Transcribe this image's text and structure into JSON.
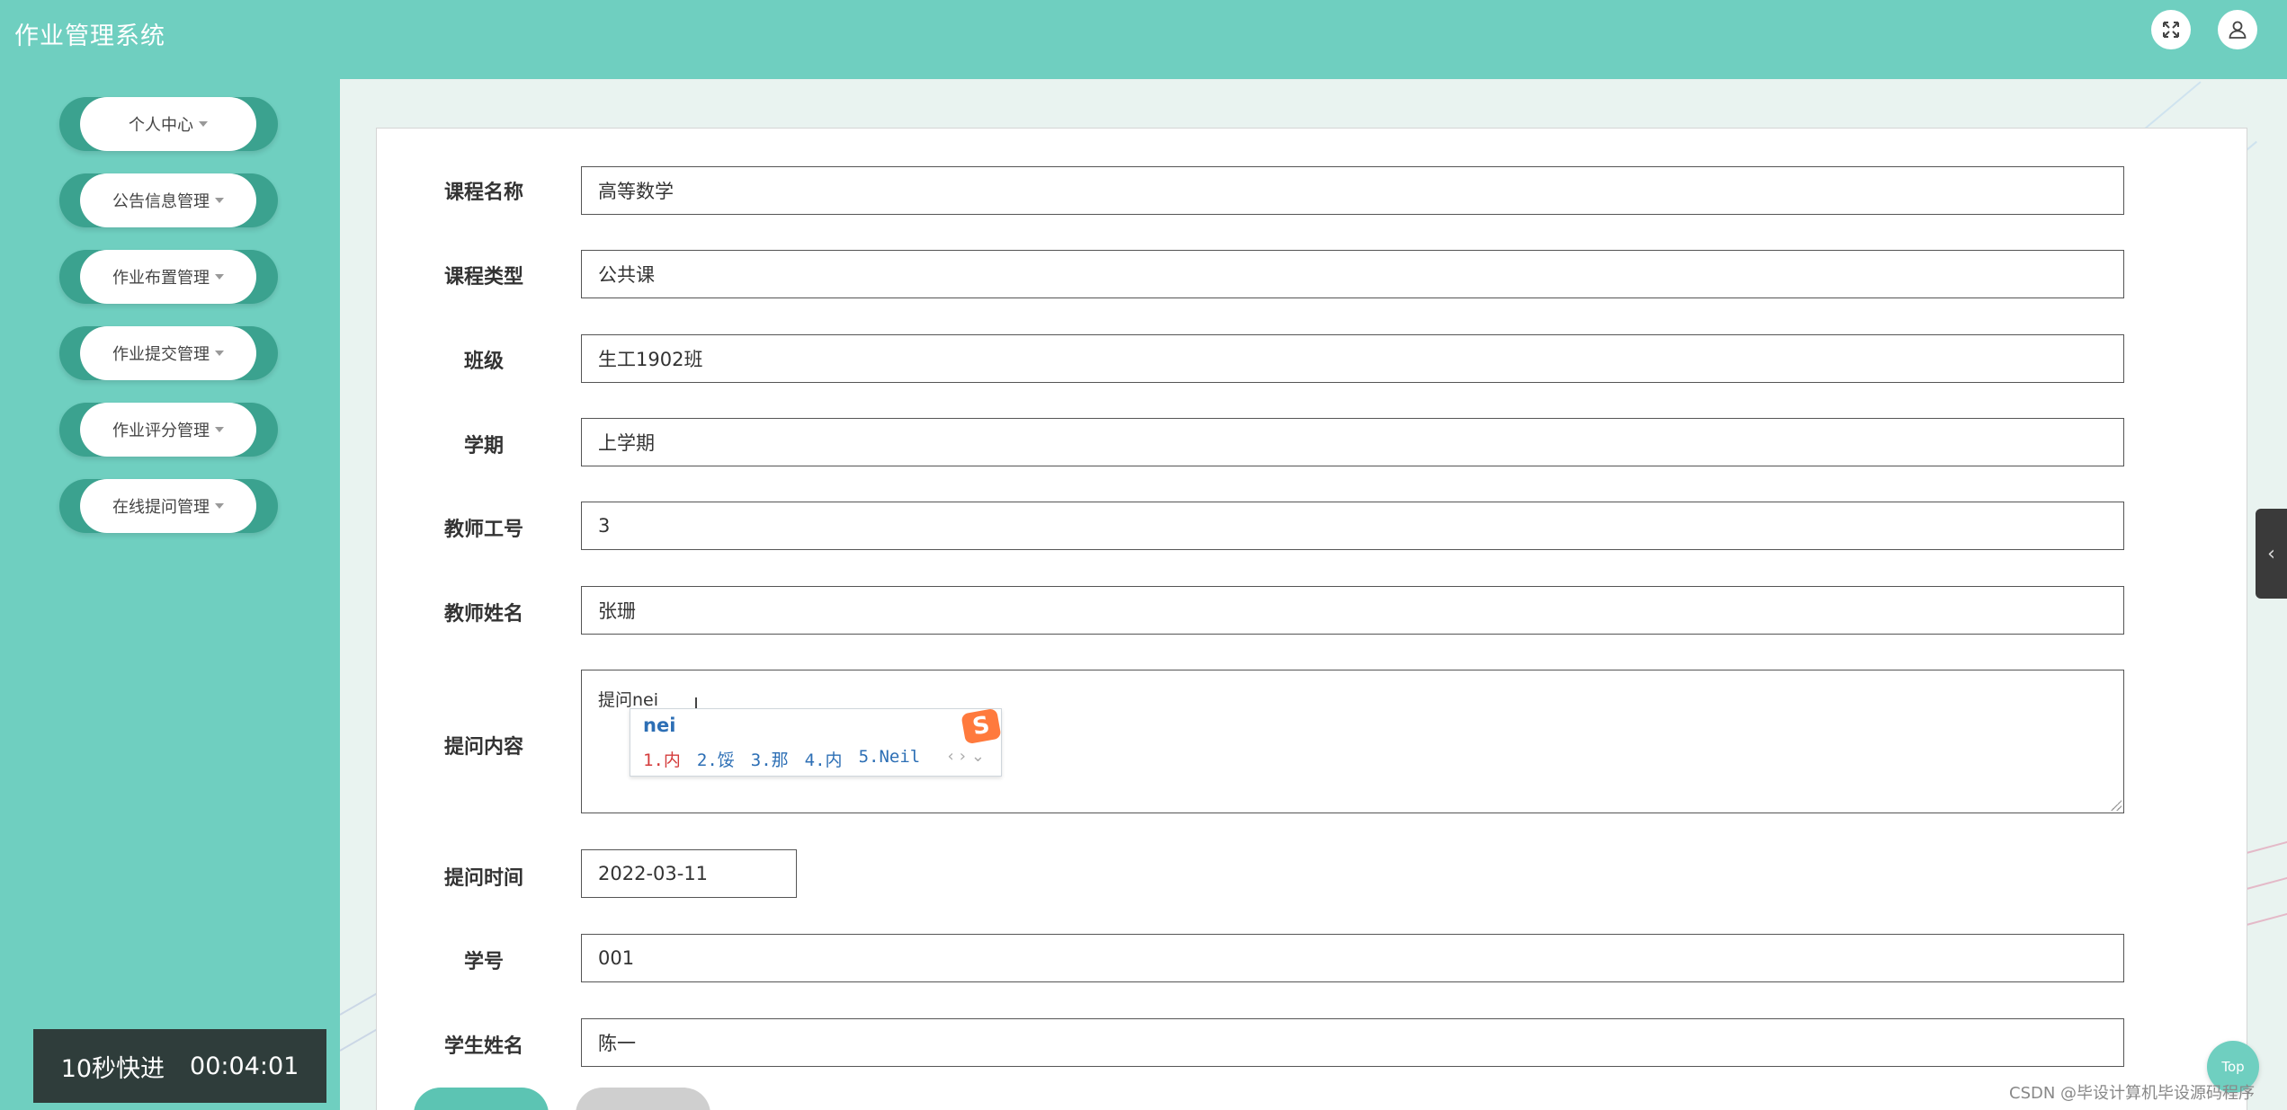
{
  "app": {
    "title": "作业管理系统"
  },
  "header": {
    "fullscreen_icon": "expand-icon",
    "user_icon": "user-icon"
  },
  "sidebar": {
    "items": [
      {
        "label": "个人中心"
      },
      {
        "label": "公告信息管理"
      },
      {
        "label": "作业布置管理"
      },
      {
        "label": "作业提交管理"
      },
      {
        "label": "作业评分管理"
      },
      {
        "label": "在线提问管理"
      }
    ]
  },
  "video_overlay": {
    "skip_label": "10秒快进",
    "time": "00:04:01"
  },
  "form": {
    "fields": [
      {
        "label": "课程名称",
        "value": "高等数学"
      },
      {
        "label": "课程类型",
        "value": "公共课"
      },
      {
        "label": "班级",
        "value": "生工1902班"
      },
      {
        "label": "学期",
        "value": "上学期"
      },
      {
        "label": "教师工号",
        "value": "3"
      },
      {
        "label": "教师姓名",
        "value": "张珊"
      },
      {
        "label": "提问内容",
        "value": "提问nei"
      },
      {
        "label": "提问时间",
        "value": "2022-03-11"
      },
      {
        "label": "学号",
        "value": "001"
      },
      {
        "label": "学生姓名",
        "value": "陈一"
      }
    ]
  },
  "ime": {
    "input": "nei",
    "candidates": [
      "1.内",
      "2.馁",
      "3.那",
      "4.内",
      "5.Neil"
    ],
    "logo": "S"
  },
  "top_button": {
    "label": "Top"
  },
  "watermark": "CSDN @毕设计算机毕设源码程序",
  "colors": {
    "primary": "#6fcfc0",
    "menu_accent": "#3ba28f",
    "panel_bg": "#ffffff"
  }
}
